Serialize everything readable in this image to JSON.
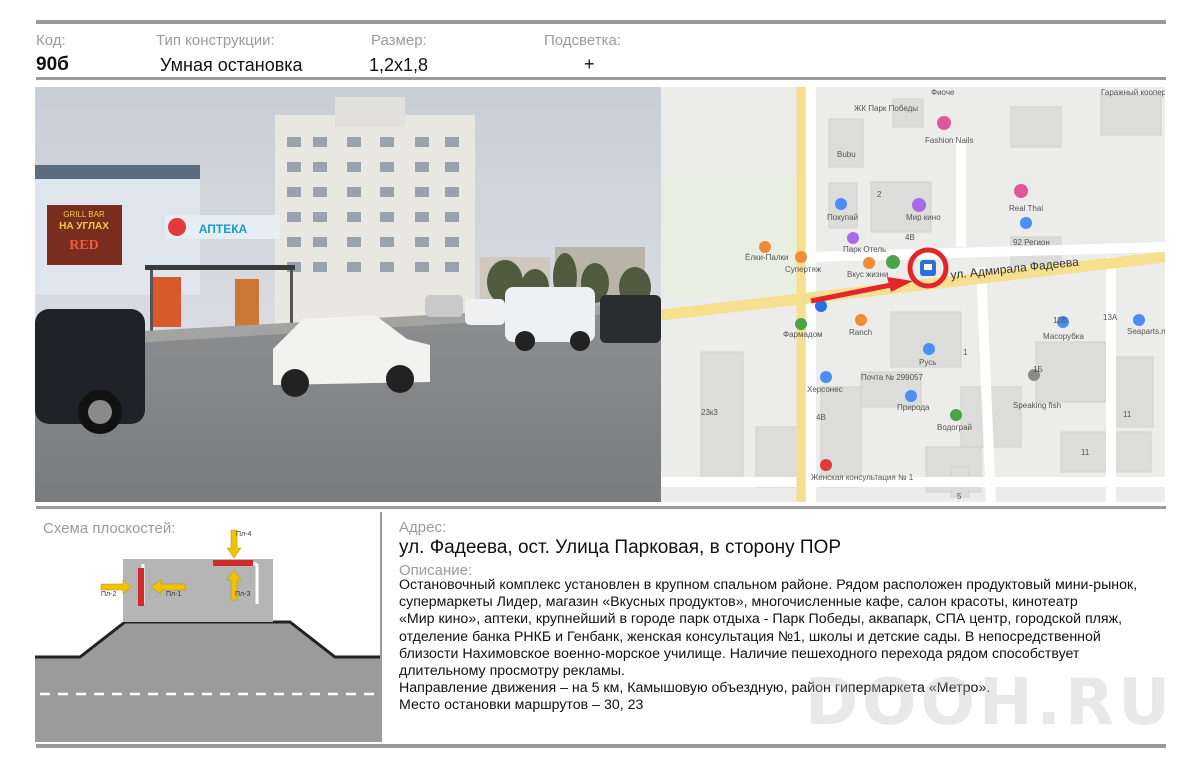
{
  "header": {
    "code_label": "Код:",
    "code_value": "90б",
    "type_label": "Тип конструкции:",
    "type_value": "Умная остановка",
    "size_label": "Размер:",
    "size_value": "1,2x1,8",
    "light_label": "Подсветка:",
    "light_value": "+"
  },
  "photo": {
    "sign_grill": "GRILL BAR",
    "sign_nauglah": "НА УГЛАХ",
    "sign_red": "RED",
    "sign_pharmacy": "АПТЕКА"
  },
  "map": {
    "street": "ул. Адмирала Фадеева",
    "labels": [
      "ЖК Парк Победы",
      "Фиоче",
      "Гаражный кооператив",
      "Fashion Nails",
      "Bubu",
      "Real Thai",
      "92 Регион",
      "Покупай",
      "Мир кино",
      "Парк Отель",
      "Ёлки-Палки",
      "Супертяж",
      "Вкус жизни",
      "Ranch",
      "Фармадом",
      "Херсонес",
      "Масорубка",
      "Seaparts.ru",
      "Русь",
      "Почта № 299057",
      "Природа",
      "Speaking fish",
      "Водограй",
      "Женская консультация № 1"
    ],
    "house_numbers": [
      "2",
      "4В",
      "13В",
      "13А",
      "1",
      "1Б",
      "11",
      "23к3",
      "4В",
      "11",
      "5"
    ],
    "marker_icon": "bus-stop-icon",
    "arrow_color": "#e3262a",
    "circle_color": "#e3262a"
  },
  "scheme": {
    "title": "Схема плоскостей:",
    "planes": [
      "Пл-1",
      "Пл-2",
      "Пл-3",
      "Пл-4"
    ],
    "plane_color": "#cf2b2b",
    "arrow_color": "#f2c200"
  },
  "address": {
    "label": "Адрес:",
    "value": "ул. Фадеева, ост. Улица Парковая, в сторону ПОР"
  },
  "description": {
    "label": "Описание:",
    "lines": [
      "Остановочный комплекс установлен в крупном спальном районе. Рядом расположен продуктовый мини-рынок,",
      "супермаркеты Лидер, магазин «Вкусных продуктов», многочисленные  кафе, салон красоты, кинотеатр",
      "«Мир кино»,  аптеки,  крупнейший в городе парк отдыха - Парк Победы, аквапарк, СПА центр, городской пляж,",
      "отделение банка РНКБ и Генбанк, женская консультация №1, школы и детские сады. В непосредственной",
      "близости Нахимовское военно-морское училище. Наличие пешеходного перехода рядом способствует",
      "длительному просмотру рекламы.",
      "Направление движения –  на 5 км, Камышовую объездную, район гипермаркета «Метро».",
      "Место остановки маршрутов – 30, 23"
    ]
  },
  "watermark": "DOOH.RU"
}
